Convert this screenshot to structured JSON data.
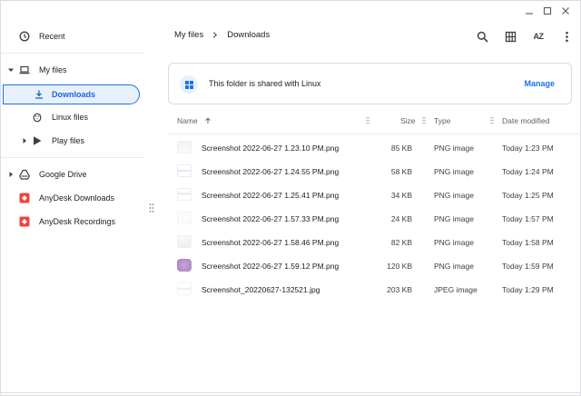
{
  "window": {
    "minimize_icon": "minimize-icon",
    "maximize_icon": "maximize-icon",
    "close_icon": "close-icon"
  },
  "sidebar": {
    "items": [
      {
        "label": "Recent",
        "icon": "clock-icon"
      },
      {
        "label": "My files",
        "icon": "laptop-icon",
        "expanded": true
      },
      {
        "label": "Downloads",
        "icon": "download-icon",
        "selected": true
      },
      {
        "label": "Linux files",
        "icon": "penguin-icon"
      },
      {
        "label": "Play files",
        "icon": "play-icon",
        "expandable": true
      },
      {
        "label": "Google Drive",
        "icon": "drive-icon",
        "expandable": true
      },
      {
        "label": "AnyDesk Downloads",
        "icon": "anydesk-icon"
      },
      {
        "label": "AnyDesk Recordings",
        "icon": "anydesk-icon"
      }
    ]
  },
  "breadcrumb": {
    "root": "My files",
    "current": "Downloads"
  },
  "toolbar": {
    "sort_label": "AZ"
  },
  "banner": {
    "text": "This folder is shared with Linux",
    "action": "Manage"
  },
  "columns": {
    "name": "Name",
    "size": "Size",
    "type": "Type",
    "date": "Date modified"
  },
  "files": [
    {
      "name": "Screenshot 2022-06-27 1.23.10 PM.png",
      "size": "85 KB",
      "type": "PNG image",
      "date": "Today 1:23 PM"
    },
    {
      "name": "Screenshot 2022-06-27 1.24.55 PM.png",
      "size": "58 KB",
      "type": "PNG image",
      "date": "Today 1:24 PM"
    },
    {
      "name": "Screenshot 2022-06-27 1.25.41 PM.png",
      "size": "34 KB",
      "type": "PNG image",
      "date": "Today 1:25 PM"
    },
    {
      "name": "Screenshot 2022-06-27 1.57.33 PM.png",
      "size": "24 KB",
      "type": "PNG image",
      "date": "Today 1:57 PM"
    },
    {
      "name": "Screenshot 2022-06-27 1.58.46 PM.png",
      "size": "82 KB",
      "type": "PNG image",
      "date": "Today 1:58 PM"
    },
    {
      "name": "Screenshot 2022-06-27 1.59.12 PM.png",
      "size": "120 KB",
      "type": "PNG image",
      "date": "Today 1:59 PM"
    },
    {
      "name": "Screenshot_20220627-132521.jpg",
      "size": "203 KB",
      "type": "JPEG image",
      "date": "Today 1:29 PM"
    }
  ],
  "colors": {
    "accent": "#1a73e8",
    "selected_bg": "#e8f0fe",
    "anydesk": "#ef443b"
  }
}
